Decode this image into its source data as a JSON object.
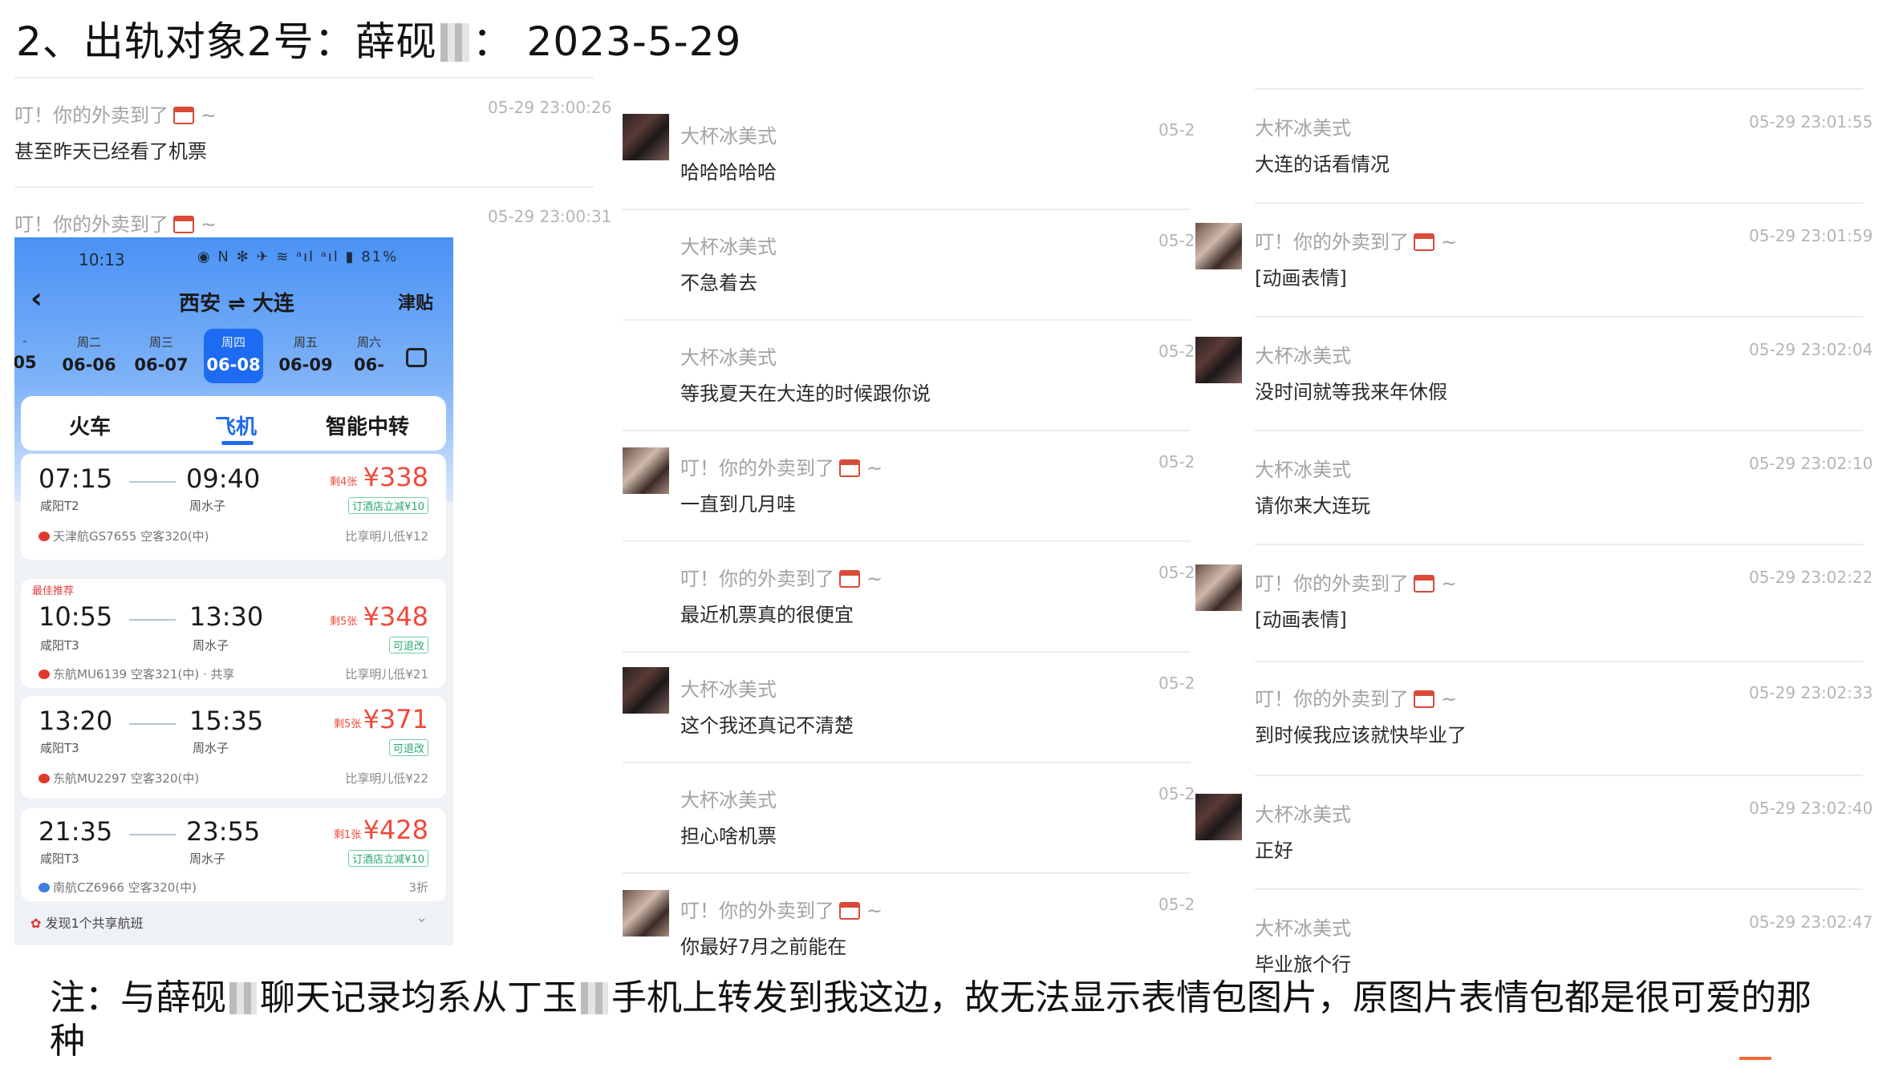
{
  "title": {
    "prefix": "2、出轨对象2号：",
    "name": "薛砚",
    "colon": "：",
    "date": "2023-5-29"
  },
  "column1": {
    "messages": [
      {
        "sender": "叮！你的外卖到了",
        "text": "甚至昨天已经看了机票",
        "time": "05-29 23:00:26"
      },
      {
        "sender": "叮！你的外卖到了",
        "time": "05-29 23:00:31"
      }
    ]
  },
  "phone": {
    "status_time": "10:13",
    "status_icons": "◉ N ✻ ✈ ≋ ᵃıl ᵃıl ▮ 81%",
    "route": "西安 ⇌ 大连",
    "subsidy": "津贴",
    "dates": [
      {
        "weekday": "-",
        "date": "05"
      },
      {
        "weekday": "周二",
        "date": "06-06"
      },
      {
        "weekday": "周三",
        "date": "06-07"
      },
      {
        "weekday": "周四",
        "date": "06-08"
      },
      {
        "weekday": "周五",
        "date": "06-09"
      },
      {
        "weekday": "周六",
        "date": "06-"
      }
    ],
    "tabs": [
      "火车",
      "飞机",
      "智能中转"
    ],
    "flights": [
      {
        "dep": "07:15",
        "arr": "09:40",
        "dep_ap": "咸阳T2",
        "arr_ap": "周水子",
        "remain": "剩4张",
        "price": "¥338",
        "tag": "订酒店立减¥10",
        "airline": "天津航GS7655 空客320(中)",
        "extra": "比享明儿低¥12",
        "rec": ""
      },
      {
        "dep": "10:55",
        "arr": "13:30",
        "dep_ap": "咸阳T3",
        "arr_ap": "周水子",
        "remain": "剩5张",
        "price": "¥348",
        "tag": "可退改",
        "airline": "东航MU6139 空客321(中) · 共享",
        "extra": "比享明儿低¥21",
        "rec": "最佳推荐"
      },
      {
        "dep": "13:20",
        "arr": "15:35",
        "dep_ap": "咸阳T3",
        "arr_ap": "周水子",
        "remain": "剩5张",
        "price": "¥371",
        "tag": "可退改",
        "airline": "东航MU2297 空客320(中)",
        "extra": "比享明儿低¥22",
        "rec": ""
      },
      {
        "dep": "21:35",
        "arr": "23:55",
        "dep_ap": "咸阳T3",
        "arr_ap": "周水子",
        "remain": "剩1张",
        "price": "¥428",
        "tag": "订酒店立减¥10",
        "airline": "南航CZ6966 空客320(中)",
        "extra": "3折",
        "rec": ""
      }
    ],
    "share_note": "发现1个共享航班"
  },
  "column2": {
    "messages": [
      {
        "sender": "大杯冰美式",
        "text": "哈哈哈哈哈",
        "time": "05-2"
      },
      {
        "sender": "大杯冰美式",
        "text": "不急着去",
        "time": "05-2"
      },
      {
        "sender": "大杯冰美式",
        "text": "等我夏天在大连的时候跟你说",
        "time": "05-2"
      },
      {
        "sender": "叮！你的外卖到了",
        "text": "一直到几月哇",
        "time": "05-2"
      },
      {
        "sender": "叮！你的外卖到了",
        "text": "最近机票真的很便宜",
        "time": "05-2"
      },
      {
        "sender": "大杯冰美式",
        "text": "这个我还真记不清楚",
        "time": "05-2"
      },
      {
        "sender": "大杯冰美式",
        "text": "担心啥机票",
        "time": "05-2"
      },
      {
        "sender": "叮！你的外卖到了",
        "text": "你最好7月之前能在",
        "time": "05-2"
      }
    ]
  },
  "column3": {
    "messages": [
      {
        "sender": "大杯冰美式",
        "text": "大连的话看情况",
        "time": "05-29 23:01:55"
      },
      {
        "sender": "叮！你的外卖到了",
        "text": "[动画表情]",
        "time": "05-29 23:01:59"
      },
      {
        "sender": "大杯冰美式",
        "text": "没时间就等我来年休假",
        "time": "05-29 23:02:04"
      },
      {
        "sender": "大杯冰美式",
        "text": "请你来大连玩",
        "time": "05-29 23:02:10"
      },
      {
        "sender": "叮！你的外卖到了",
        "text": "[动画表情]",
        "time": "05-29 23:02:22"
      },
      {
        "sender": "叮！你的外卖到了",
        "text": "到时候我应该就快毕业了",
        "time": "05-29 23:02:33"
      },
      {
        "sender": "大杯冰美式",
        "text": "正好",
        "time": "05-29 23:02:40"
      },
      {
        "sender": "大杯冰美式",
        "text": "毕业旅个行",
        "time": "05-29 23:02:47"
      }
    ]
  },
  "note": {
    "part1": "注：与薛砚",
    "part2": "聊天记录均系从丁玉",
    "part3": "手机上转发到我这边，故无法显示表情包图片，原图片表情包都是很可爱的那种"
  }
}
